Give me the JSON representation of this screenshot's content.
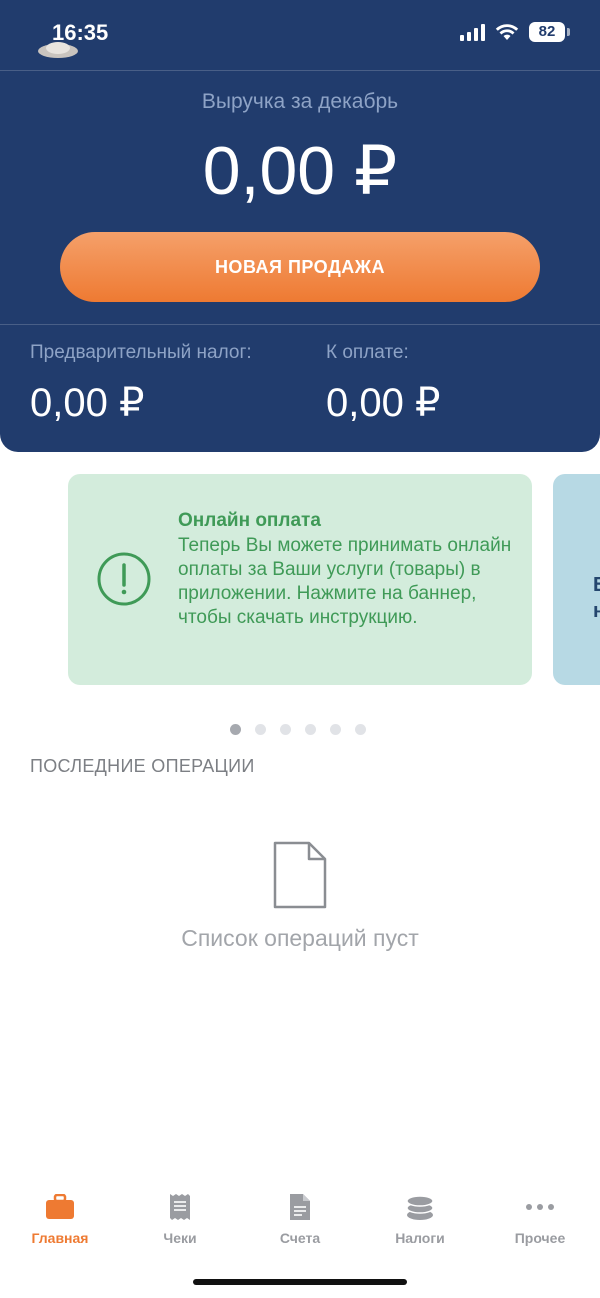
{
  "status_bar": {
    "time": "16:35",
    "battery": "82"
  },
  "header": {
    "revenue_label": "Выручка за декабрь",
    "revenue_value": "0,00 ₽",
    "new_sale_button": "НОВАЯ ПРОДАЖА",
    "prelim_tax_label": "Предварительный налог:",
    "prelim_tax_value": "0,00 ₽",
    "to_pay_label": "К оплате:",
    "to_pay_value": "0,00 ₽"
  },
  "banner": {
    "title": "Онлайн оплата",
    "text": "Теперь Вы можете принимать онлайн оплаты за Ваши услуги (товары) в приложении. Нажмите на баннер, чтобы скачать инструкцию.",
    "icon": "alert-circle-icon",
    "next_peek_line1": "Б",
    "next_peek_line2": "н"
  },
  "carousel": {
    "total": 6,
    "active_index": 0
  },
  "operations": {
    "section_title": "ПОСЛЕДНИЕ ОПЕРАЦИИ",
    "empty_text": "Список операций пуст"
  },
  "tabs": [
    {
      "label": "Главная",
      "icon": "briefcase-icon",
      "active": true
    },
    {
      "label": "Чеки",
      "icon": "receipt-icon",
      "active": false
    },
    {
      "label": "Счета",
      "icon": "document-icon",
      "active": false
    },
    {
      "label": "Налоги",
      "icon": "coins-icon",
      "active": false
    },
    {
      "label": "Прочее",
      "icon": "more-icon",
      "active": false
    }
  ],
  "colors": {
    "header_bg": "#213c6d",
    "accent_orange": "#ee7a32",
    "banner_green_bg": "#d3ecdc",
    "banner_green_text": "#3f9a57",
    "banner_blue_bg": "#b7d9e4"
  }
}
